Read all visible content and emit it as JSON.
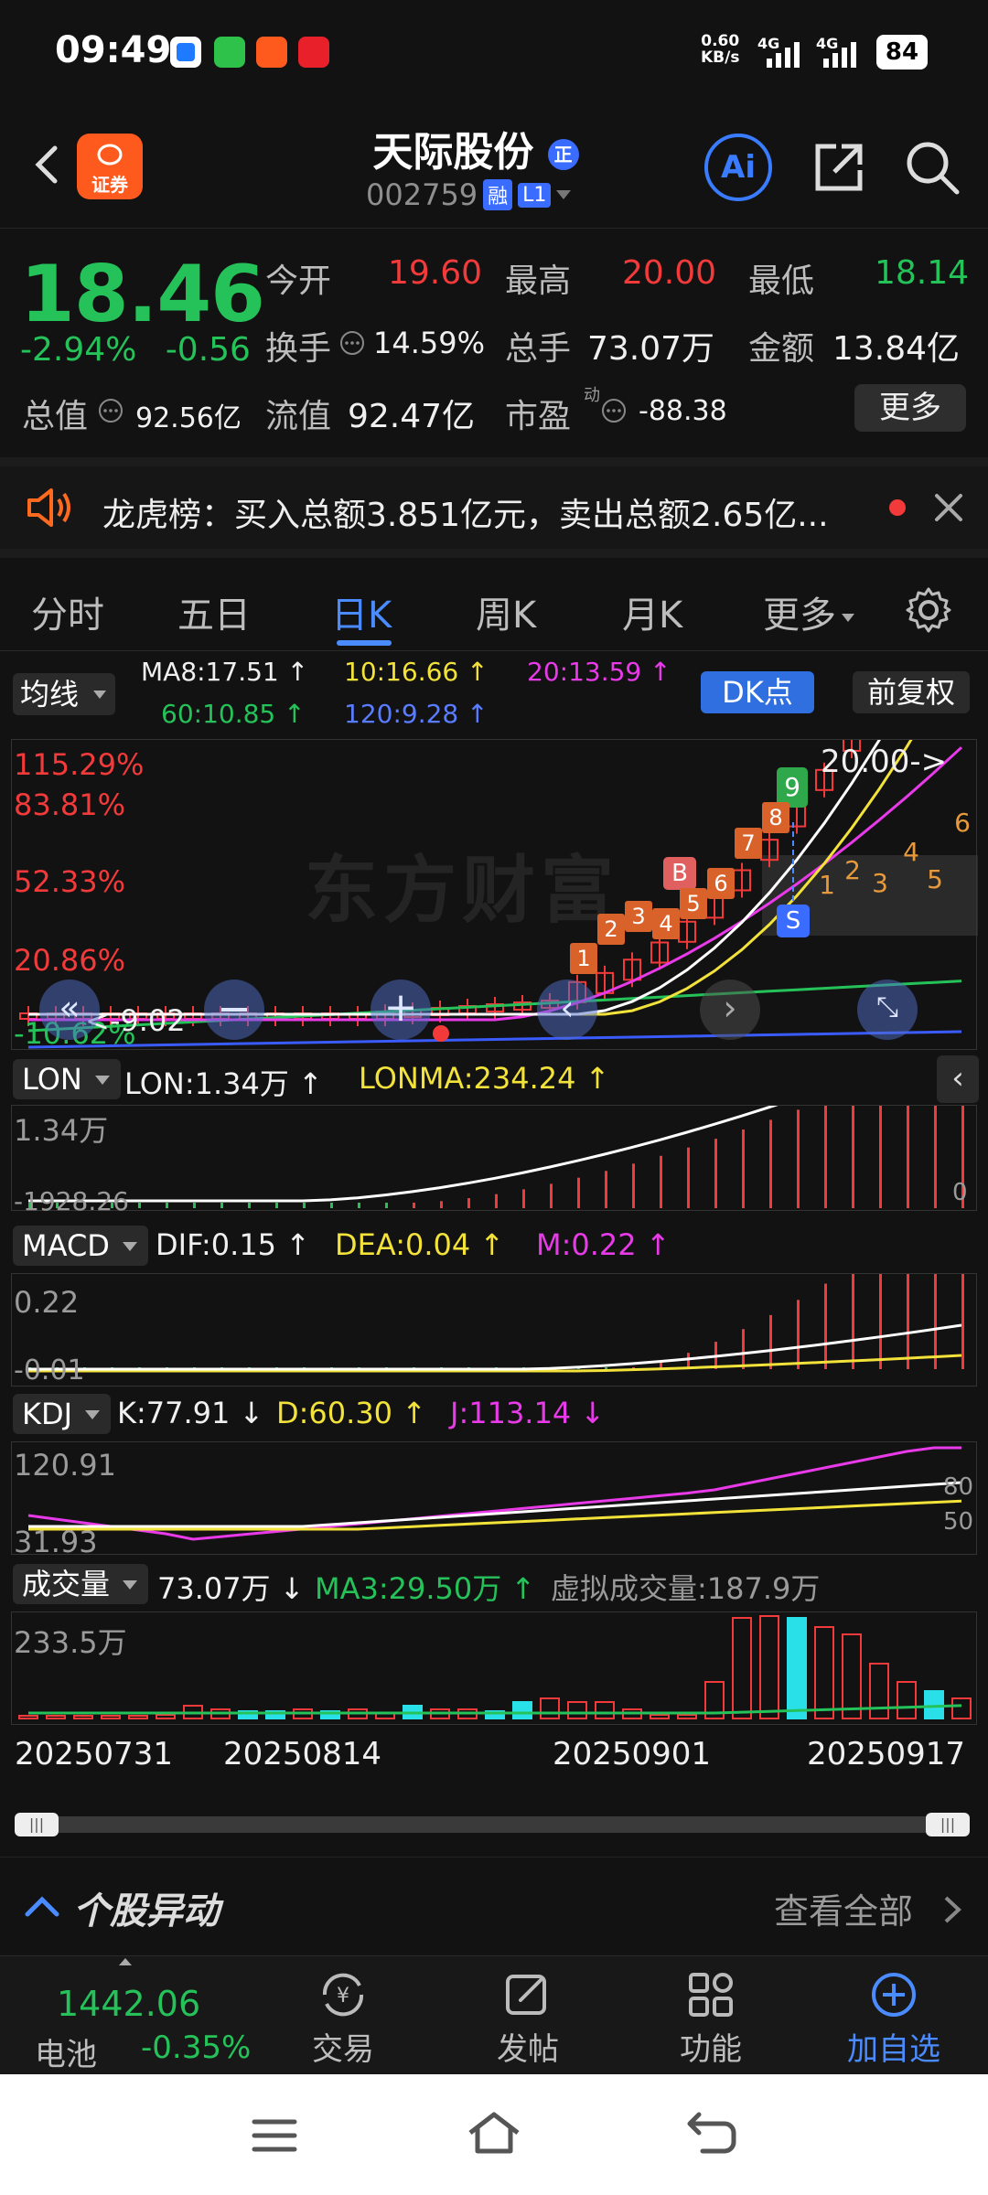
{
  "status_bar": {
    "time": "09:49",
    "net_speed_top": "0.60",
    "net_speed_bottom": "KB/s",
    "sig1": "4G",
    "sig2": "4G",
    "battery": "84"
  },
  "header": {
    "logo_text": "证券",
    "name": "天际股份",
    "name_badge": "正",
    "code": "002759",
    "tag_rong": "融",
    "tag_level": "L1",
    "ai_label": "Ai"
  },
  "quote": {
    "price": "18.46",
    "change_pct": "-2.94%",
    "change_amt": "-0.56",
    "open_label": "今开",
    "open": "19.60",
    "high_label": "最高",
    "high": "20.00",
    "low_label": "最低",
    "low": "18.14",
    "turnover_label": "换手",
    "turnover": "14.59%",
    "volume_label": "总手",
    "volume": "73.07万",
    "amount_label": "金额",
    "amount": "13.84亿",
    "mktcap_label": "总值",
    "mktcap": "92.56亿",
    "float_label": "流值",
    "float_cap": "92.47亿",
    "pe_label": "市盈",
    "pe_sup": "动",
    "pe": "-88.38",
    "more": "更多"
  },
  "notice": {
    "text": "龙虎榜：买入总额3.851亿元，卖出总额2.65亿..."
  },
  "tabs": [
    "分时",
    "五日",
    "日K",
    "周K",
    "月K",
    "更多"
  ],
  "ma_bar": {
    "selector": "均线",
    "ma8": "MA8:17.51 ↑",
    "ma10": "10:16.66 ↑",
    "ma20": "20:13.59 ↑",
    "ma60": "60:10.85 ↑",
    "ma120": "120:9.28 ↑",
    "dk": "DK点",
    "adjust": "前复权"
  },
  "kline": {
    "y_labels": [
      "115.29%",
      "83.81%",
      "52.33%",
      "20.86%",
      "-10.62%"
    ],
    "high_marker": "20.00->",
    "low_marker": "<-9.02",
    "watermark": "东方财富",
    "signal_b": "B",
    "signal_s": "S",
    "signal_9": "9",
    "counts_up": [
      "1",
      "2",
      "3",
      "4",
      "5",
      "6",
      "7",
      "8"
    ],
    "counts_down": [
      "1",
      "2",
      "3",
      "4",
      "5",
      "6"
    ]
  },
  "lon": {
    "selector": "LON",
    "value": "LON:1.34万 ↑",
    "ma": "LONMA:234.24 ↑",
    "y_top": "1.34万",
    "y_bottom": "-1928.26",
    "y_right": "0"
  },
  "macd": {
    "selector": "MACD",
    "dif": "DIF:0.15 ↑",
    "dea": "DEA:0.04 ↑",
    "m": "M:0.22 ↑",
    "y_top": "0.22",
    "y_bottom": "-0.01"
  },
  "kdj": {
    "selector": "KDJ",
    "k": "K:77.91 ↓",
    "d": "D:60.30 ↑",
    "j": "J:113.14 ↓",
    "y_top": "120.91",
    "y_bottom": "31.93",
    "y_r80": "80",
    "y_r50": "50"
  },
  "volume": {
    "selector": "成交量",
    "vol": "73.07万 ↓",
    "ma3": "MA3:29.50万 ↑",
    "virtual": "虚拟成交量:187.9万",
    "y_top": "233.5万"
  },
  "dates": [
    "20250731",
    "20250814",
    "20250901",
    "20250917"
  ],
  "movement": {
    "title": "个股异动",
    "view_all": "查看全部"
  },
  "bottom_nav": {
    "index_value": "1442.06",
    "index_name": "电池",
    "index_change": "-0.35%",
    "trade": "交易",
    "post": "发帖",
    "func": "功能",
    "add": "加自选"
  },
  "colors": {
    "up": "#f23a3a",
    "down": "#25c25a",
    "accent": "#4a8cff",
    "brand": "#ff5a1e",
    "ma8": "#ffffff",
    "ma10": "#f2e23a",
    "ma20": "#e83ae8",
    "ma60": "#25c25a",
    "ma120": "#3a5cff"
  }
}
